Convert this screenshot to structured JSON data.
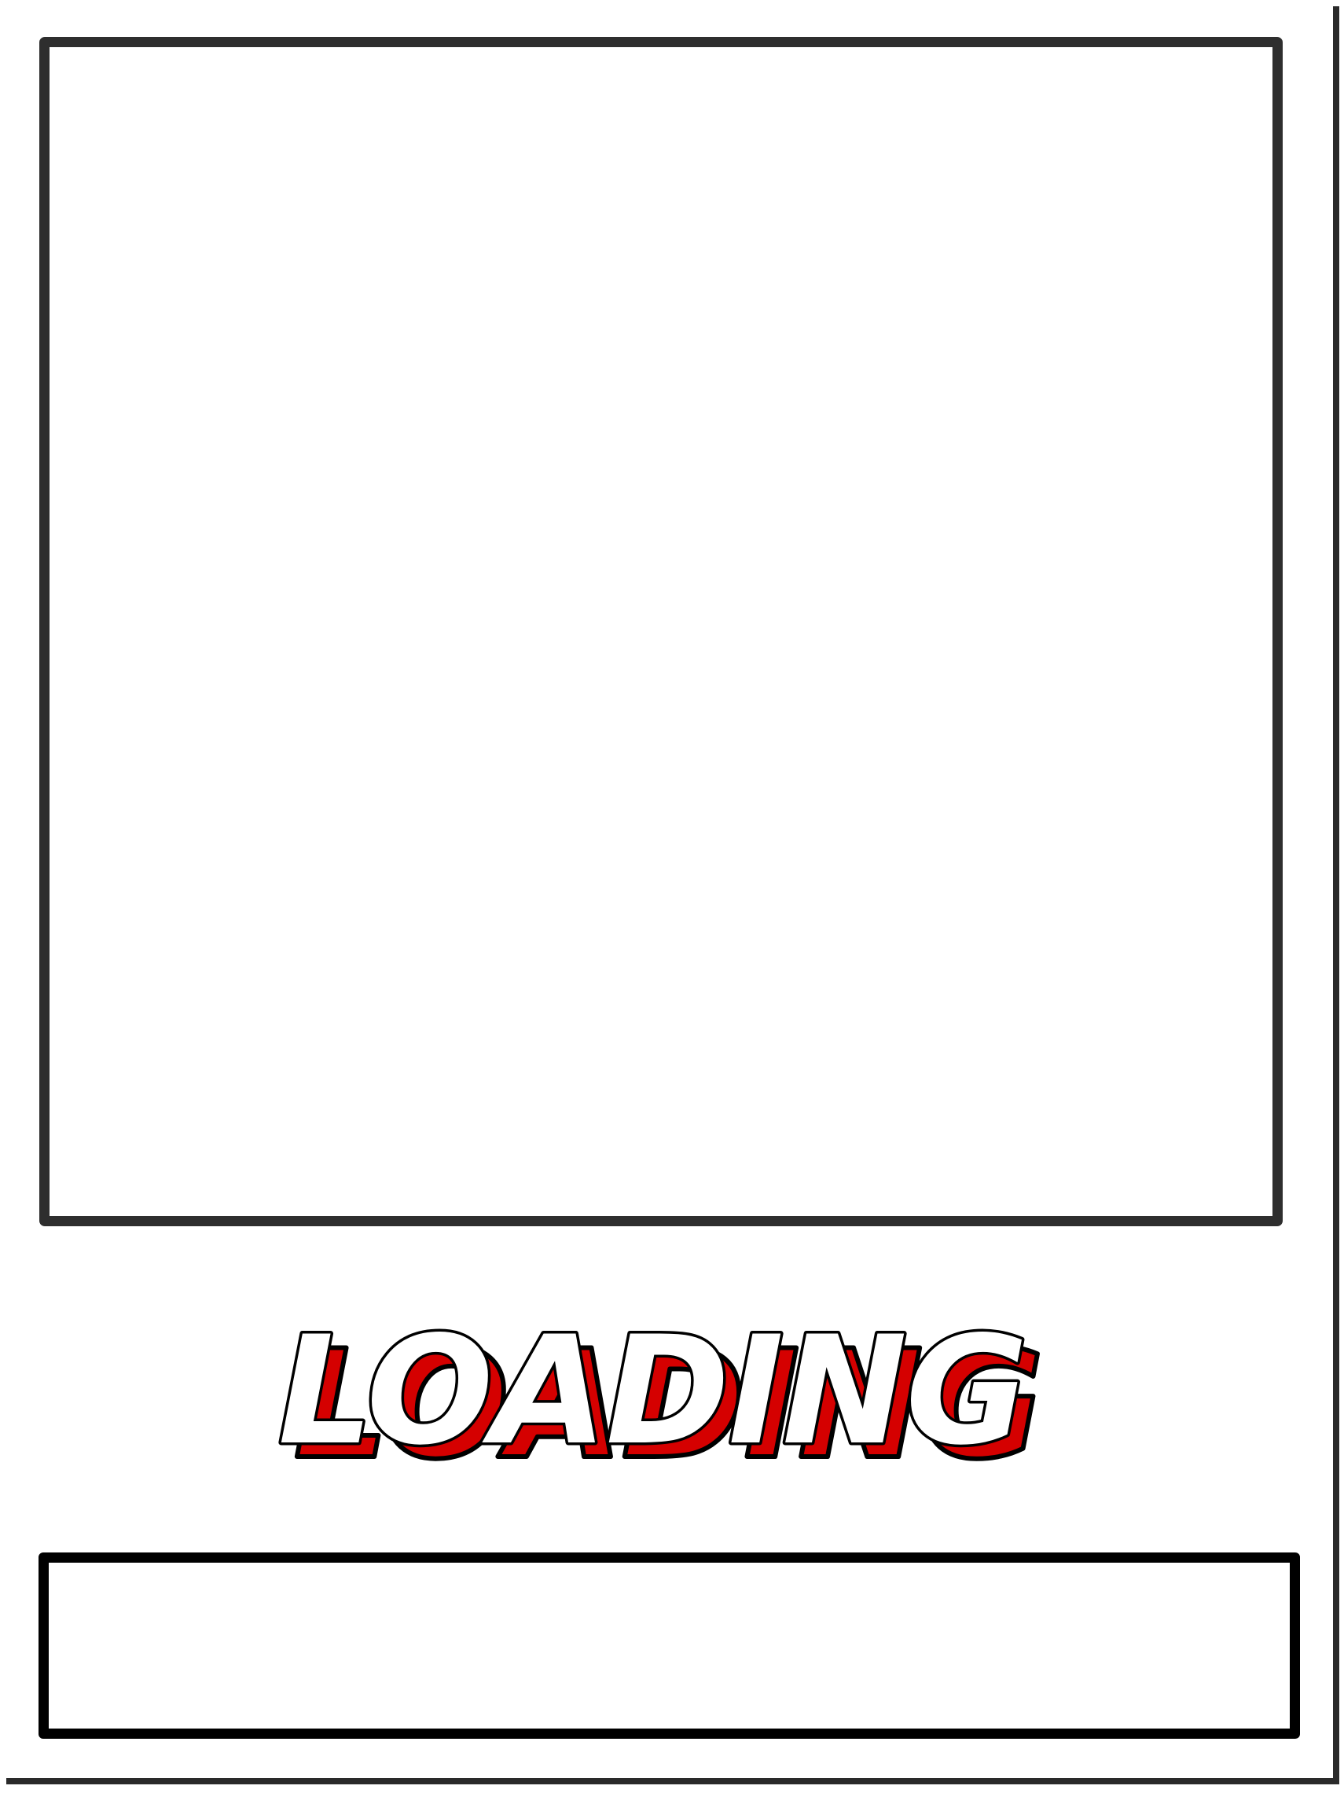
{
  "loading": {
    "label": "LOADING"
  },
  "progress": {
    "fraction": 0
  },
  "colors": {
    "frame": "#2e2e2e",
    "text_fill": "#ffffff",
    "text_outline": "#000000",
    "text_shadow": "#d50000",
    "page_shadow": "#2a2a2a"
  }
}
